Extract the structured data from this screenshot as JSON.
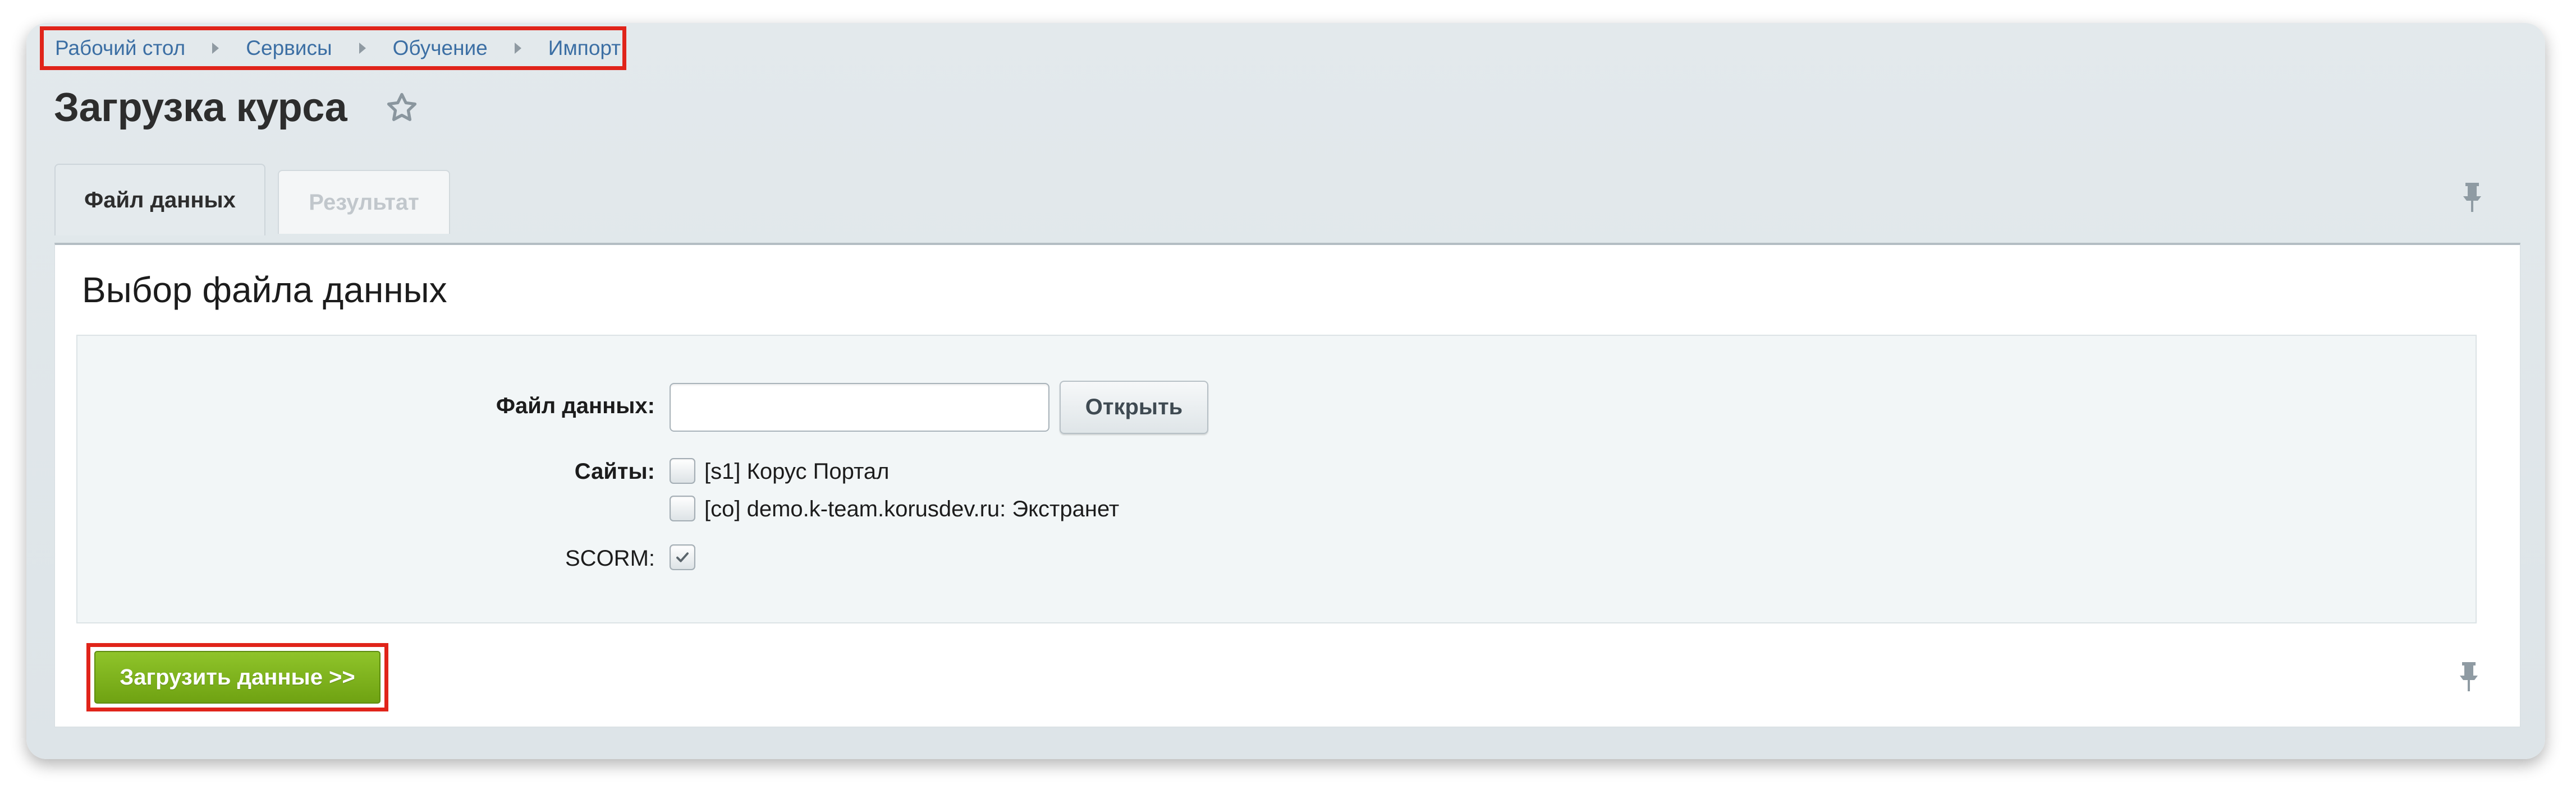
{
  "breadcrumb": {
    "items": [
      "Рабочий стол",
      "Сервисы",
      "Обучение",
      "Импорт"
    ]
  },
  "page": {
    "title": "Загрузка курса"
  },
  "tabs": [
    {
      "label": "Файл данных",
      "active": true
    },
    {
      "label": "Результат",
      "active": false
    }
  ],
  "section": {
    "title": "Выбор файла данных"
  },
  "form": {
    "file_label": "Файл данных:",
    "file_value": "",
    "open_button": "Открыть",
    "sites_label": "Сайты:",
    "sites": [
      {
        "label": "[s1] Корус Портал",
        "checked": false
      },
      {
        "label": "[co] demo.k-team.korusdev.ru: Экстранет",
        "checked": false
      }
    ],
    "scorm_label": "SCORM:",
    "scorm_checked": true
  },
  "actions": {
    "submit_label": "Загрузить данные >>"
  },
  "icons": {
    "favorite": "star-icon",
    "pin": "pin-icon",
    "breadcrumb_separator": "triangle-right-icon",
    "check": "checkmark-icon"
  },
  "colors": {
    "link": "#3c6fa4",
    "submit": "#7ab01c",
    "highlight": "#e0241a"
  }
}
